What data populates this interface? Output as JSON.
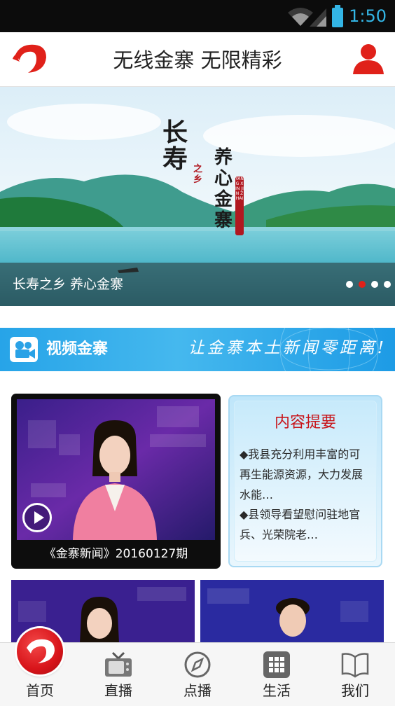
{
  "status_bar": {
    "time": "1:50",
    "accent": "#33b5e5"
  },
  "header": {
    "title": "无线金寨 无限精彩",
    "logo_icon": "app-logo-icon",
    "user_icon": "user-profile-icon",
    "brand_color": "#e0211a"
  },
  "banner": {
    "caption": "长寿之乡 养心金寨",
    "slide_count": 4,
    "active_slide": 2,
    "poem": {
      "line1": "长寿",
      "line2": "之乡",
      "line3": "养心金寨",
      "seal": "YANG XIN JIN ZHAI"
    }
  },
  "section": {
    "brand": "视频金寨",
    "slogan": "让金寨本土新闻零距离!"
  },
  "featured_video": {
    "title": "《金寨新闻》20160127期"
  },
  "summary": {
    "heading": "内容提要",
    "items": [
      "◆我县充分利用丰富的可再生能源资源，大力发展水能…",
      "◆县领导看望慰问驻地官兵、光荣院老…"
    ]
  },
  "bottom_nav": [
    {
      "label": "首页",
      "icon": "home-logo-icon"
    },
    {
      "label": "直播",
      "icon": "tv-icon"
    },
    {
      "label": "点播",
      "icon": "compass-icon"
    },
    {
      "label": "生活",
      "icon": "grid-icon"
    },
    {
      "label": "我们",
      "icon": "book-icon"
    }
  ]
}
